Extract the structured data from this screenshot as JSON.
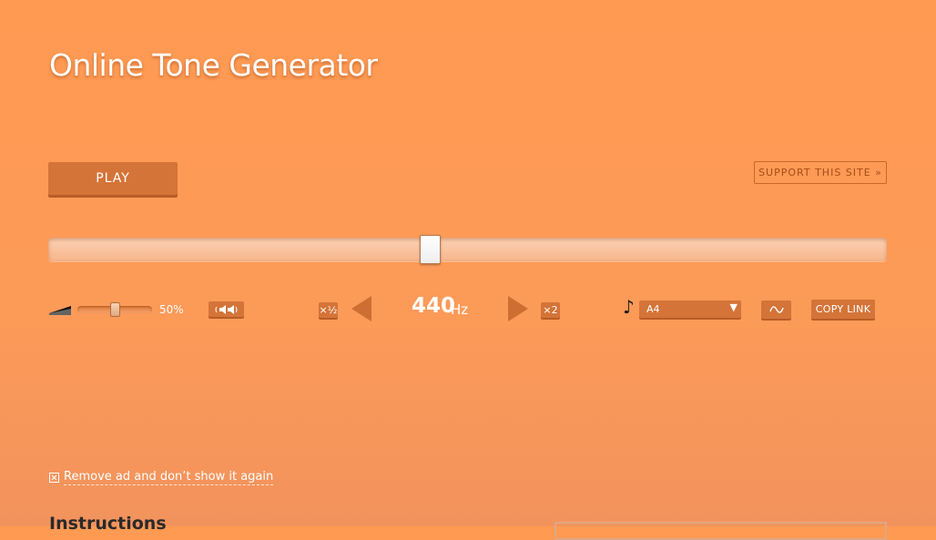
{
  "page": {
    "title": "Online Tone Generator"
  },
  "controls": {
    "play_label": "PLAY",
    "support_label": "SUPPORT THIS SITE »",
    "frequency": {
      "value": "440",
      "unit": "Hz",
      "slider_fraction": 0.455
    },
    "volume": {
      "label": "50%",
      "fraction": 0.5
    },
    "half_label": "×½",
    "double_label": "×2",
    "note": {
      "selected": "A4",
      "arrow": "▼"
    },
    "copy_link_label": "COPY LINK"
  },
  "ad": {
    "remove_label": "Remove ad and don’t show it again"
  },
  "sections": {
    "instructions_title": "Instructions"
  },
  "icons": [
    "volume-icon",
    "balance-icon",
    "prev-frequency-icon",
    "next-frequency-icon",
    "music-note-icon",
    "sine-wave-icon",
    "close-box-icon"
  ],
  "colors": {
    "background": "#ff9a52",
    "button": "#d47438",
    "button_shadow": "#b95c26",
    "arrow": "#cd6f33",
    "support_text": "#a84c16"
  }
}
